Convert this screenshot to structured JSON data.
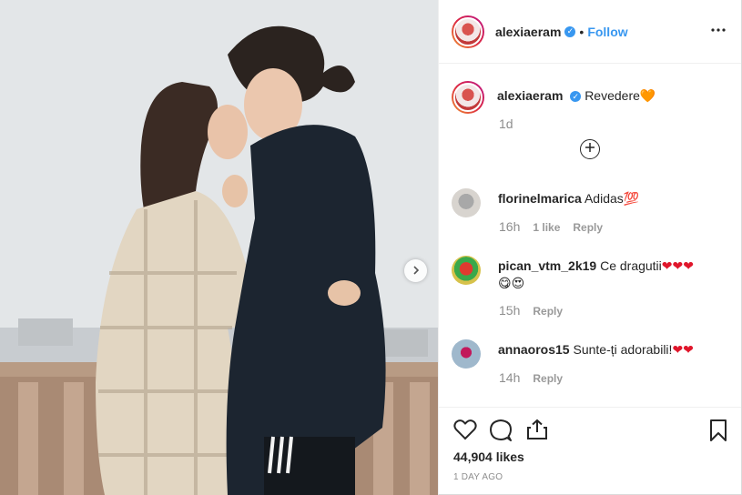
{
  "post": {
    "author": "alexiaeram",
    "follow_label": "Follow",
    "separator": "•",
    "caption": "Revedere",
    "caption_emoji": "🧡",
    "caption_time": "1d",
    "likes": "44,904 likes",
    "date": "1 DAY AGO"
  },
  "comments": [
    {
      "username": "florinelmarica",
      "text": "Adidas",
      "emoji": "💯",
      "time": "16h",
      "likes": "1 like",
      "reply": "Reply"
    },
    {
      "username": "pican_vtm_2k19",
      "text": "Ce dragutii",
      "emoji": "❤❤❤",
      "emoji2": "😋😍",
      "time": "15h",
      "reply": "Reply"
    },
    {
      "username": "annaoros15",
      "text": "Sunte-ți adorabili!",
      "emoji": "❤❤",
      "time": "14h",
      "reply": "Reply"
    }
  ],
  "icons": {
    "more": "more-options-icon",
    "next": "chevron-right-icon",
    "like": "heart-icon",
    "comment": "comment-icon",
    "share": "share-icon",
    "save": "bookmark-icon",
    "load_more": "plus-circle-icon"
  },
  "colors": {
    "accent": "#3897f0",
    "verified": "#3897f0",
    "heart": "#e0162b",
    "muted": "#8e8e8e"
  }
}
